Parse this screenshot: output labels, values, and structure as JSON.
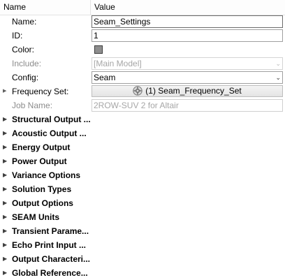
{
  "header": {
    "name": "Name",
    "value": "Value"
  },
  "props": {
    "name_label": "Name:",
    "name_value": "Seam_Settings",
    "id_label": "ID:",
    "id_value": "1",
    "color_label": "Color:",
    "color_value": "#8e8e8e",
    "include_label": "Include:",
    "include_value": "[Main Model]",
    "config_label": "Config:",
    "config_value": "Seam",
    "freq_label": "Frequency Set:",
    "freq_value": "(1) Seam_Frequency_Set",
    "job_label": "Job Name:",
    "job_value": "2ROW-SUV 2 for Altair"
  },
  "groups": [
    "Structural Output ...",
    "Acoustic Output ...",
    "Energy Output",
    "Power Output",
    "Variance Options",
    "Solution Types",
    "Output Options",
    "SEAM Units",
    "Transient Parame...",
    "Echo Print Input ...",
    "Output Characteri...",
    "Global Reference..."
  ],
  "icons": {
    "expand": "triangle-right-icon",
    "dropdown": "chevron-down-icon",
    "gear": "gear-icon"
  }
}
